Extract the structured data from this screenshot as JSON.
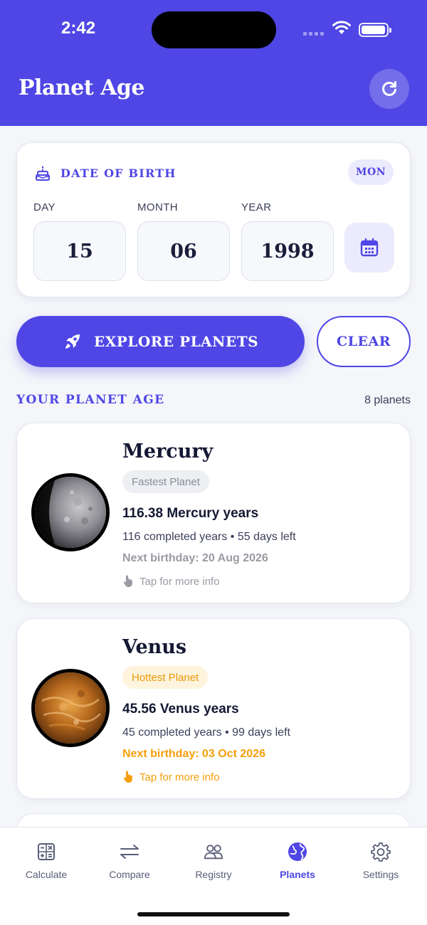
{
  "status_bar": {
    "time": "2:42"
  },
  "header": {
    "title": "Planet Age"
  },
  "dob_card": {
    "title": "DATE OF BIRTH",
    "weekday_badge": "MON",
    "fields": [
      {
        "label": "DAY",
        "value": "15"
      },
      {
        "label": "MONTH",
        "value": "06"
      },
      {
        "label": "YEAR",
        "value": "1998"
      }
    ]
  },
  "actions": {
    "explore_label": "EXPLORE PLANETS",
    "clear_label": "CLEAR"
  },
  "section": {
    "title": "YOUR PLANET AGE",
    "count": "8 planets"
  },
  "planets": [
    {
      "name": "Mercury",
      "tag": "Fastest Planet",
      "age": "116.38 Mercury years",
      "progress": "116 completed years • 55 days left",
      "next_birthday": "Next birthday: 20 Aug 2026",
      "tap_hint": "Tap for more info",
      "accent": "#9a9aa3"
    },
    {
      "name": "Venus",
      "tag": "Hottest Planet",
      "age": "45.56 Venus years",
      "progress": "45 completed years • 99 days left",
      "next_birthday": "Next birthday: 03 Oct 2026",
      "tap_hint": "Tap for more info",
      "accent": "#f59e0b"
    }
  ],
  "tabs": [
    {
      "label": "Calculate",
      "icon": "calculator-icon",
      "active": false
    },
    {
      "label": "Compare",
      "icon": "compare-arrows-icon",
      "active": false
    },
    {
      "label": "Registry",
      "icon": "people-icon",
      "active": false
    },
    {
      "label": "Planets",
      "icon": "globe-icon",
      "active": true
    },
    {
      "label": "Settings",
      "icon": "gear-icon",
      "active": false
    }
  ],
  "colors": {
    "primary": "#4f46e5",
    "background": "#f5f6fa",
    "venus_accent": "#f59e0b"
  }
}
